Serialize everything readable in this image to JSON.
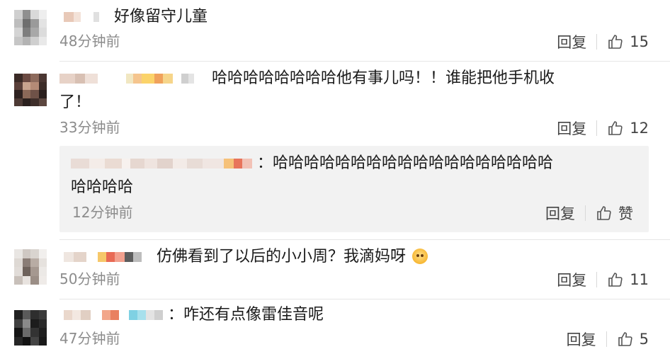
{
  "comments": [
    {
      "text": "好像留守儿童",
      "time": "48分钟前",
      "reply_label": "回复",
      "likes": "15"
    },
    {
      "text_line1": "哈哈哈哈哈哈哈哈他有事儿吗！！谁能把他手机收",
      "text_line2": "了！",
      "time": "33分钟前",
      "reply_label": "回复",
      "likes": "12",
      "sub_reply": {
        "text_line1": "：哈哈哈哈哈哈哈哈哈哈哈哈哈哈哈哈哈哈",
        "text_line2": "哈哈哈哈",
        "time": "12分钟前",
        "reply_label": "回复",
        "like_label": "赞"
      }
    },
    {
      "text": "仿佛看到了以后的小小周？我滴妈呀",
      "emoji": "face-emoji",
      "time": "50分钟前",
      "reply_label": "回复",
      "likes": "11"
    },
    {
      "text": "：咋还有点像雷佳音呢",
      "time": "47分钟前",
      "reply_label": "回复",
      "likes": "5"
    }
  ],
  "colors": {
    "time": "#8c8c8c",
    "reply_bg": "#f2f2f2",
    "divider": "#e6e6e6"
  },
  "icons": [
    "thumbs-up-icon",
    "face-emoji-icon"
  ]
}
